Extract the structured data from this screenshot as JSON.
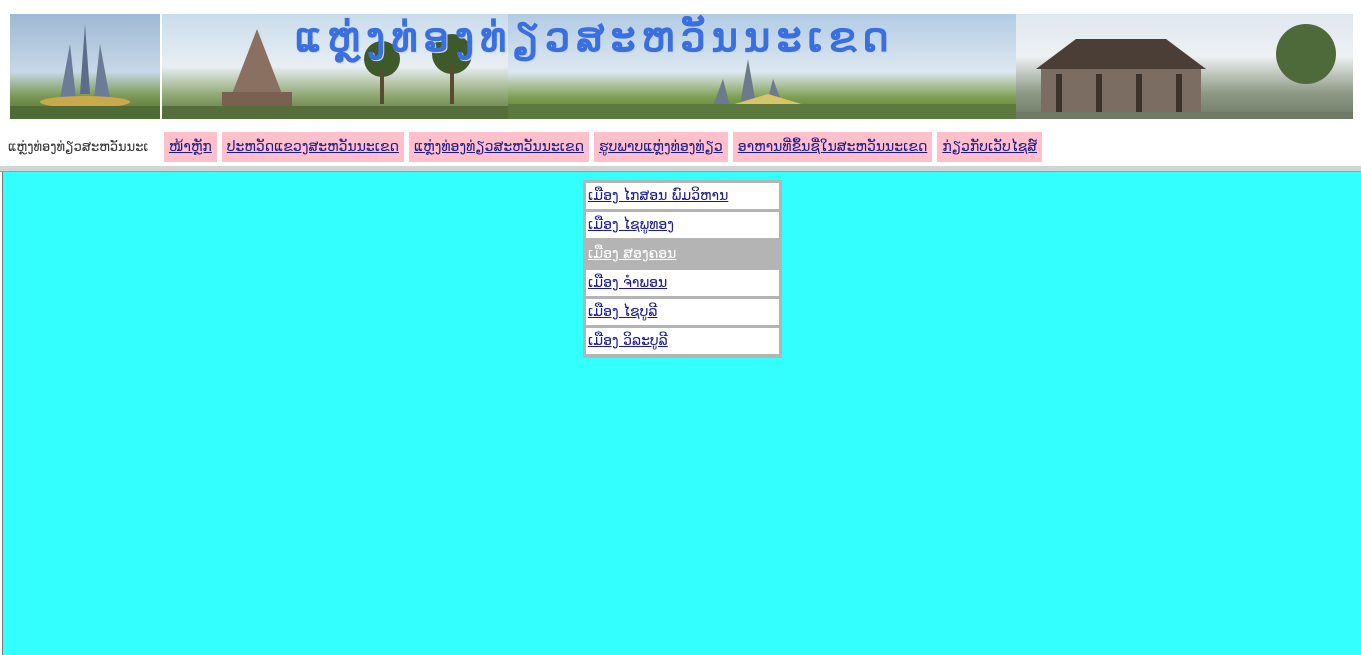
{
  "banner": {
    "title": "ແຫຼ່ງທ່ອງທ່ຽວສະຫວັນນະເຂດ",
    "photos": [
      "monument-photo",
      "temple-photo",
      "plaza-photo",
      "wooden-temple-photo"
    ]
  },
  "nav": {
    "brand": "ແຫຼ່ງທ່ອງທ່ຽວສະຫວັນນະເ",
    "items": [
      {
        "label": "ໜ້າຫຼັກ"
      },
      {
        "label": "ປະຫວັດແຂວງສະຫວັນນະເຂດ"
      },
      {
        "label": "ແຫຼ່ງທ່ອງທ່ຽວສະຫວັນນະເຂດ"
      },
      {
        "label": "ຮູບພາບແຫຼ່ງທ່ອງທ່ຽວ"
      },
      {
        "label": "ອາຫານທີ່ຂຶ້ນຊື່ໃນສະຫວັນນະເຂດ"
      },
      {
        "label": "ກ່ຽວກັບເວັບໄຊສ໌"
      }
    ]
  },
  "districts": [
    {
      "label": "ເມືອງ ໄກສອນ ພົມວິຫານ"
    },
    {
      "label": "ເມືອງ ໄຊພູທອງ"
    },
    {
      "label": "ເມືອງ ສອງຄອນ"
    },
    {
      "label": "ເມືອງ ຈຳພອນ"
    },
    {
      "label": "ເມືອງ ໄຊບູລີ"
    },
    {
      "label": "ເມືອງ ວິລະບູລີ"
    }
  ],
  "colors": {
    "nav_bg": "#ffc0cb",
    "main_bg": "#33ffff",
    "active_item_bg": "#b4b4b4"
  }
}
